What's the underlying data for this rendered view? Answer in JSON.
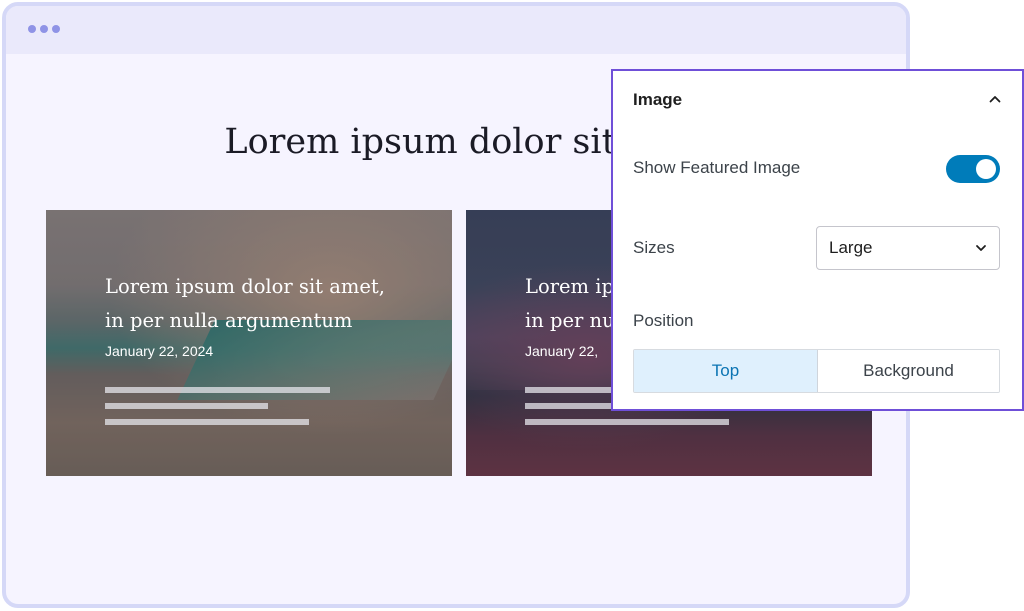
{
  "browser": {
    "dots": [
      "dot",
      "dot",
      "dot"
    ]
  },
  "page": {
    "title": "Lorem ipsum dolor sit a"
  },
  "cards": [
    {
      "title": "Lorem ipsum dolor sit amet,\nin per nulla argumentum",
      "date": "January 22, 2024"
    },
    {
      "title": "Lorem ip\nin per nu",
      "date": "January 22,"
    }
  ],
  "panel": {
    "title": "Image",
    "show_featured_image_label": "Show Featured Image",
    "show_featured_image_on": true,
    "sizes_label": "Sizes",
    "sizes_value": "Large",
    "position_label": "Position",
    "position_options": [
      "Top",
      "Background"
    ],
    "position_selected": "Top"
  },
  "colors": {
    "accent": "#007cba",
    "panel_border": "#6f4fd8",
    "frame_border": "#d5d8f7",
    "page_bg": "#f6f4ff"
  }
}
